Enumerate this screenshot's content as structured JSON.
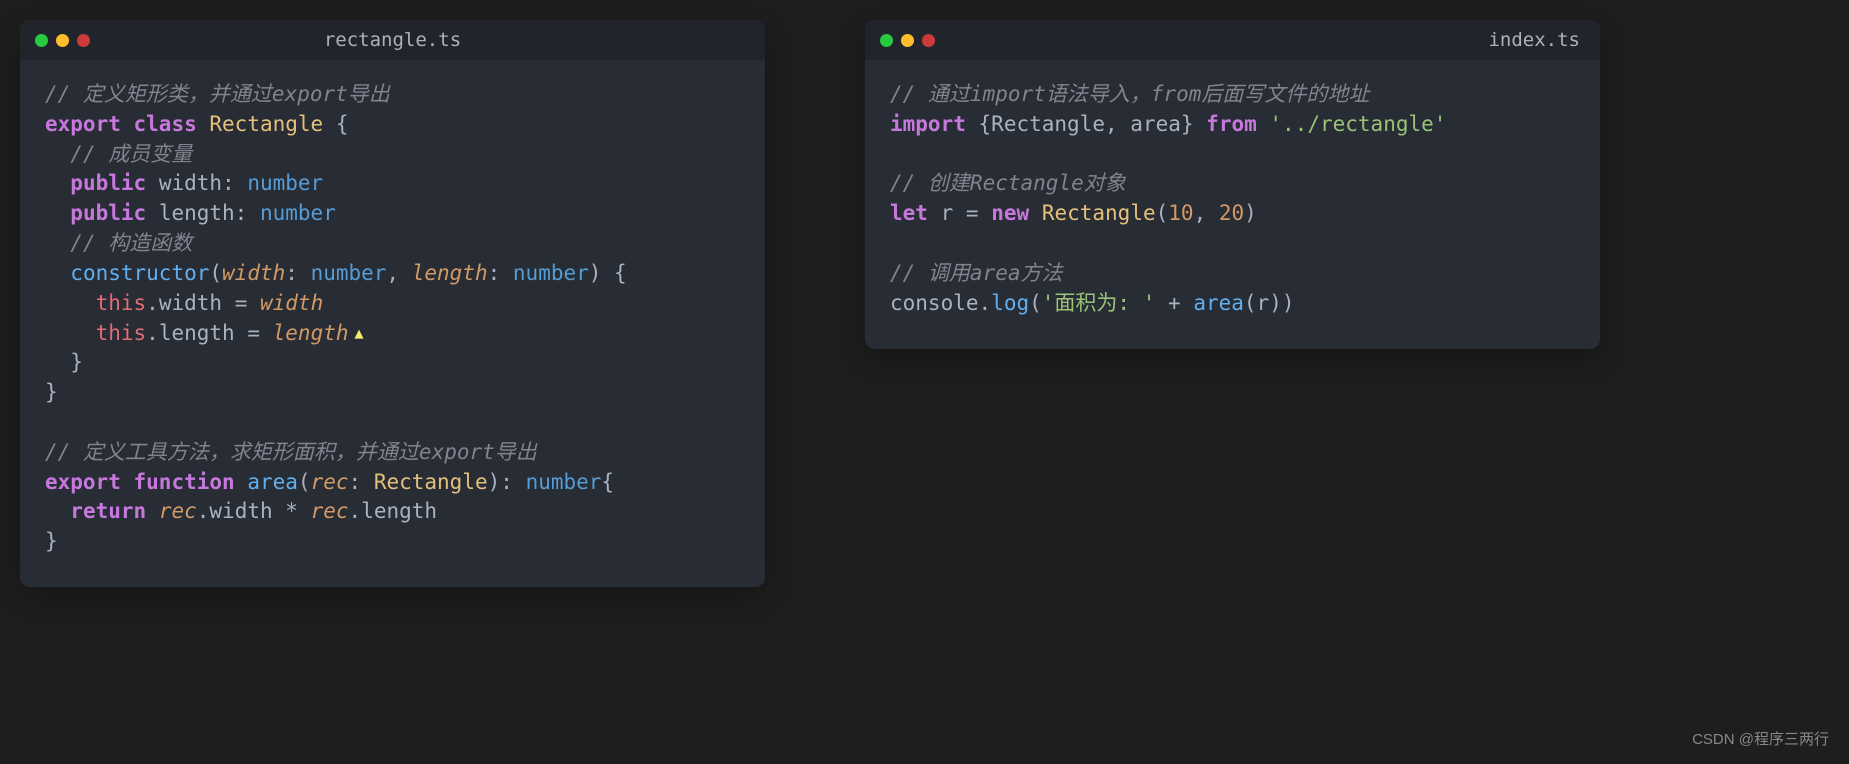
{
  "leftWindow": {
    "title": "rectangle.ts",
    "code": {
      "line1_comment": "// 定义矩形类，并通过export导出",
      "line2_export": "export",
      "line2_class": "class",
      "line2_name": "Rectangle",
      "line3_comment": "// 成员变量",
      "line4_public": "public",
      "line4_prop": "width",
      "line4_type": "number",
      "line5_public": "public",
      "line5_prop": "length",
      "line5_type": "number",
      "line6_comment": "// 构造函数",
      "line7_constructor": "constructor",
      "line7_param1": "width",
      "line7_type1": "number",
      "line7_param2": "length",
      "line7_type2": "number",
      "line8_this": "this",
      "line8_prop": "width",
      "line8_val": "width",
      "line9_this": "this",
      "line9_prop": "length",
      "line9_val": "length",
      "line12_comment": "// 定义工具方法，求矩形面积，并通过export导出",
      "line13_export": "export",
      "line13_function": "function",
      "line13_name": "area",
      "line13_param": "rec",
      "line13_ptype": "Rectangle",
      "line13_rtype": "number",
      "line14_return": "return",
      "line14_rec": "rec",
      "line14_width": "width",
      "line14_rec2": "rec",
      "line14_length": "length"
    }
  },
  "rightWindow": {
    "title": "index.ts",
    "code": {
      "line1_comment": "// 通过import语法导入，from后面写文件的地址",
      "line2_import": "import",
      "line2_rect": "Rectangle",
      "line2_area": "area",
      "line2_from": "from",
      "line2_path": "'../rectangle'",
      "line4_comment": "// 创建Rectangle对象",
      "line5_let": "let",
      "line5_r": "r",
      "line5_new": "new",
      "line5_rect": "Rectangle",
      "line5_n1": "10",
      "line5_n2": "20",
      "line7_comment": "// 调用area方法",
      "line8_console": "console",
      "line8_log": "log",
      "line8_str": "'面积为: '",
      "line8_area": "area",
      "line8_r": "r"
    }
  },
  "watermark": "CSDN @程序三两行"
}
